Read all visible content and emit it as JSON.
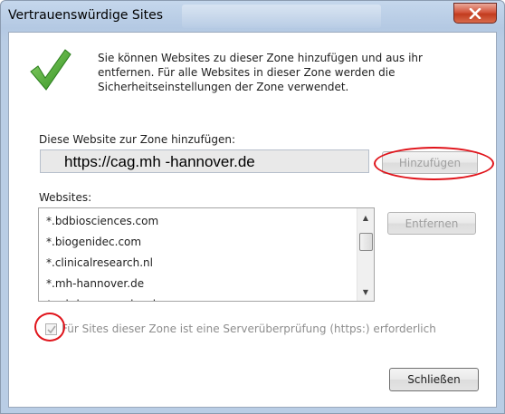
{
  "window": {
    "title": "Vertrauenswürdige Sites",
    "close_glyph": "x"
  },
  "intro": {
    "icon": "checkmark-icon",
    "text": "Sie können Websites zu dieser Zone hinzufügen und aus ihr entfernen. Für alle Websites in dieser Zone werden die Sicherheitseinstellungen der Zone verwendet."
  },
  "add_section": {
    "label": "Diese Website zur Zone hinzufügen:",
    "url_value": "https://cag.mh -hannover.de",
    "add_button": "Hinzufügen"
  },
  "websites": {
    "label": "Websites:",
    "items": [
      "*.bdbiosciences.com",
      "*.biogenidec.com",
      "*.clinicalresearch.nl",
      "*.mh-hannover.de",
      "*.mh-hannover.local"
    ],
    "remove_button": "Entfernen"
  },
  "https_check": {
    "label": "Für Sites dieser Zone ist eine Serverüberprüfung (https:) erforderlich",
    "checked": true
  },
  "close_button": "Schließen",
  "colors": {
    "annotation": "#e0141b",
    "check_green": "#3aa52a",
    "close_red": "#c94a30"
  }
}
